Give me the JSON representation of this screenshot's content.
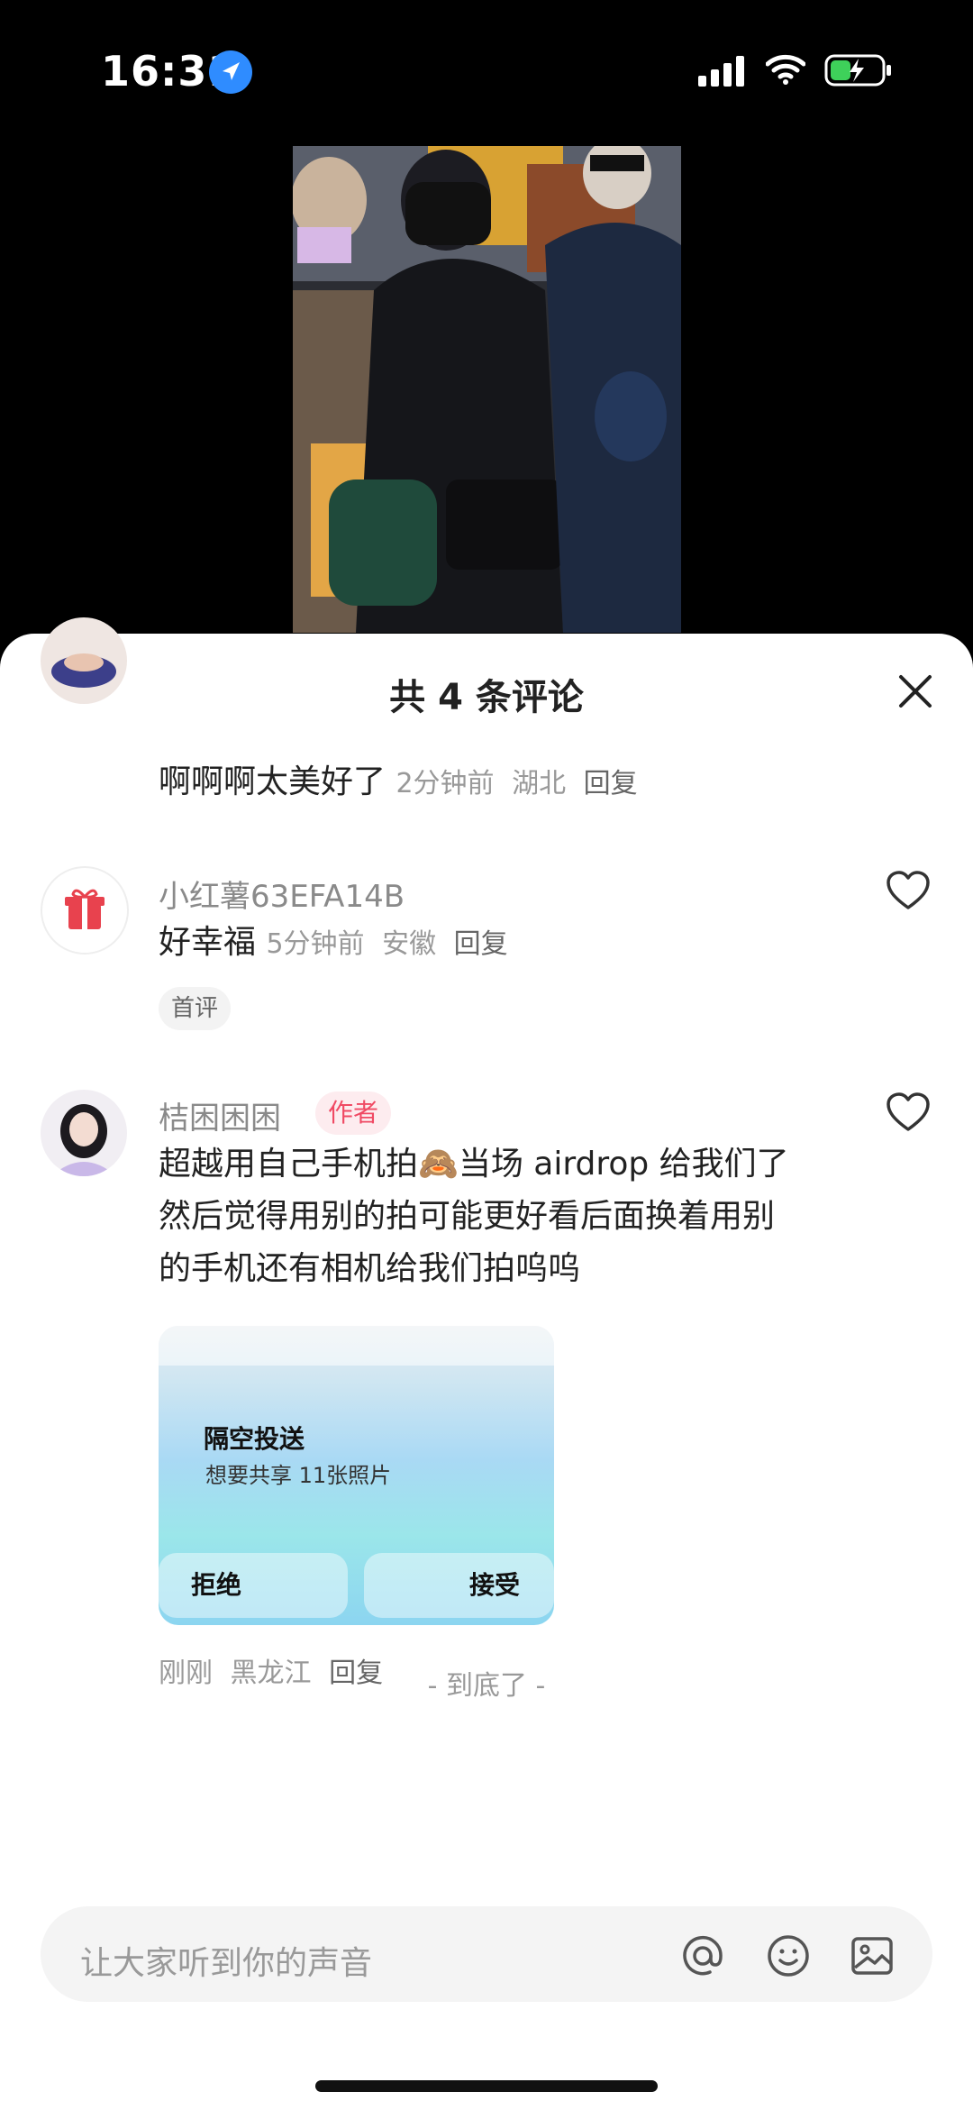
{
  "status_bar": {
    "time": "16:31"
  },
  "sheet": {
    "title": "共 4 条评论",
    "comments": [
      {
        "text": "啊啊啊太美好了",
        "time": "2分钟前",
        "location": "湖北",
        "reply": "回复"
      },
      {
        "username": "小红薯63EFA14B",
        "text": "好幸福",
        "time": "5分钟前",
        "location": "安徽",
        "reply": "回复",
        "tag": "首评"
      },
      {
        "username": "桔困困困",
        "tag": "作者",
        "text_line1": "超越用自己手机拍🙈当场 airdrop 给我们了",
        "text_line2": "然后觉得用别的拍可能更好看后面换着用别",
        "text_line3": "的手机还有相机给我们拍呜呜",
        "time": "刚刚",
        "location": "黑龙江",
        "reply": "回复",
        "shared_image": {
          "title": "隔空投送",
          "subtitle": "想要共享 11张照片",
          "decline": "拒绝",
          "accept": "接受"
        }
      }
    ],
    "end_text": "- 到底了 -"
  },
  "input_bar": {
    "placeholder": "让大家听到你的声音"
  }
}
